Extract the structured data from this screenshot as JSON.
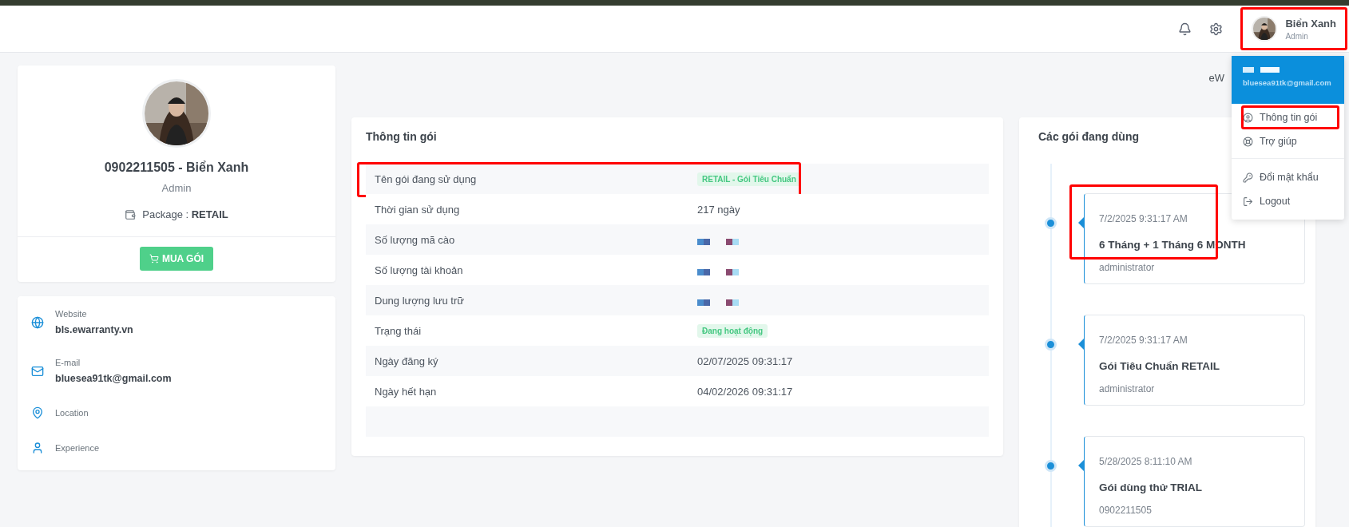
{
  "header": {
    "user": {
      "name": "Biển Xanh",
      "role": "Admin",
      "highlighted": true
    }
  },
  "user_menu": {
    "email": "bluesea91tk@gmail.com",
    "item_groups": [
      [
        {
          "kind": "package",
          "label": "Thông tin gói",
          "highlighted": true
        },
        {
          "kind": "help",
          "label": "Trợ giúp",
          "highlighted": false
        }
      ],
      [
        {
          "kind": "password",
          "label": "Đổi mật khẩu",
          "highlighted": false
        },
        {
          "kind": "logout",
          "label": "Logout",
          "highlighted": false
        }
      ]
    ]
  },
  "breadcrumb": "eW",
  "profile": {
    "title": "0902211505 - Biển Xanh",
    "role": "Admin",
    "package_label": "Package :",
    "package_value": "RETAIL",
    "buy_button": "MUA GÓI"
  },
  "contact": [
    {
      "kind": "website",
      "label": "Website",
      "value": "bls.ewarranty.vn"
    },
    {
      "kind": "email",
      "label": "E-mail",
      "value": "bluesea91tk@gmail.com"
    },
    {
      "kind": "location",
      "label": "Location"
    },
    {
      "kind": "experience",
      "label": "Experience"
    }
  ],
  "package_info": {
    "title": "Thông tin gói",
    "rows": [
      {
        "label": "Tên gói đang sử dụng",
        "kind": "badge",
        "value": "RETAIL - Gói Tiêu Chuẩn",
        "highlighted": true
      },
      {
        "label": "Thời gian sử dụng",
        "kind": "text",
        "value": "217 ngày",
        "highlighted": false
      },
      {
        "label": "Số lượng mã cào",
        "kind": "redacted",
        "highlighted": false
      },
      {
        "label": "Số lượng tài khoản",
        "kind": "redacted",
        "highlighted": false
      },
      {
        "label": "Dung lượng lưu trữ",
        "kind": "redacted",
        "highlighted": false
      },
      {
        "label": "Trạng thái",
        "kind": "badge",
        "value": "Đang hoạt động",
        "highlighted": false
      },
      {
        "label": "Ngày đăng ký",
        "kind": "text",
        "value": "02/07/2025 09:31:17",
        "highlighted": false
      },
      {
        "label": "Ngày hết hạn",
        "kind": "text",
        "value": "04/02/2026 09:31:17",
        "highlighted": false
      }
    ]
  },
  "active_packages": {
    "title": "Các gói đang dùng",
    "items": [
      {
        "date": "7/2/2025 9:31:17 AM",
        "name": "6 Tháng + 1 Tháng 6 MONTH",
        "by": "administrator",
        "highlighted": true
      },
      {
        "date": "7/2/2025 9:31:17 AM",
        "name": "Gói Tiêu Chuẩn RETAIL",
        "by": "administrator",
        "highlighted": false
      },
      {
        "date": "5/28/2025 8:11:10 AM",
        "name": "Gói dùng thử TRIAL",
        "by": "0902211505",
        "highlighted": false
      }
    ]
  }
}
